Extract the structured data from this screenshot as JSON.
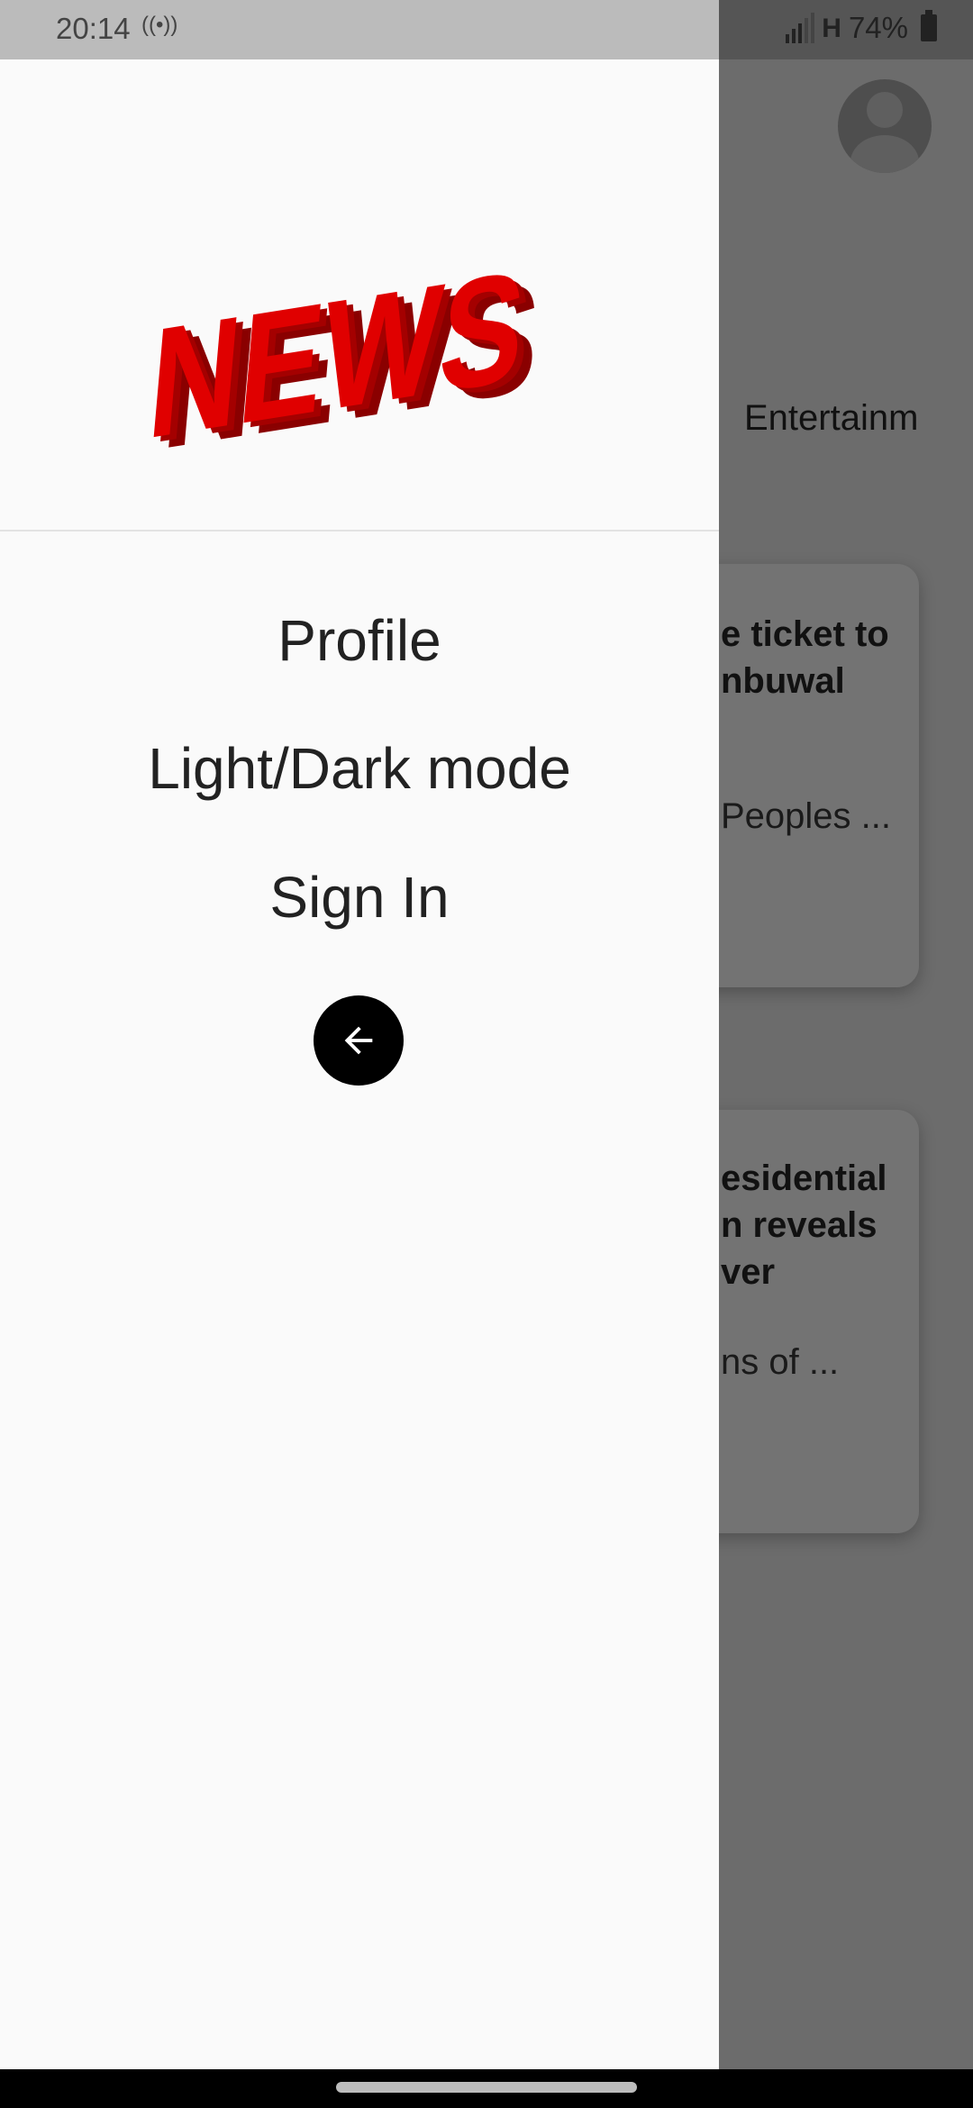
{
  "status_bar": {
    "time": "20:14",
    "hotspot_icon": "hotspot-2-icon",
    "network": "H",
    "battery": "74%"
  },
  "background": {
    "tab_label": "Entertainm",
    "cards": [
      {
        "title_lines": [
          "e ticket to",
          "nbuwal"
        ],
        "snippet": "Peoples ..."
      },
      {
        "title_lines": [
          "esidential",
          "n reveals",
          "ver"
        ],
        "snippet": "ns of ..."
      }
    ]
  },
  "drawer": {
    "logo_text": "NEWS",
    "items": [
      {
        "label": "Profile"
      },
      {
        "label": "Light/Dark mode"
      },
      {
        "label": "Sign In"
      }
    ],
    "back_icon": "arrow-left-icon"
  },
  "colors": {
    "logo_red": "#e00000",
    "logo_shadow": "#8a0000",
    "drawer_bg": "#fafafa",
    "scrim": "#6c6c6c"
  }
}
